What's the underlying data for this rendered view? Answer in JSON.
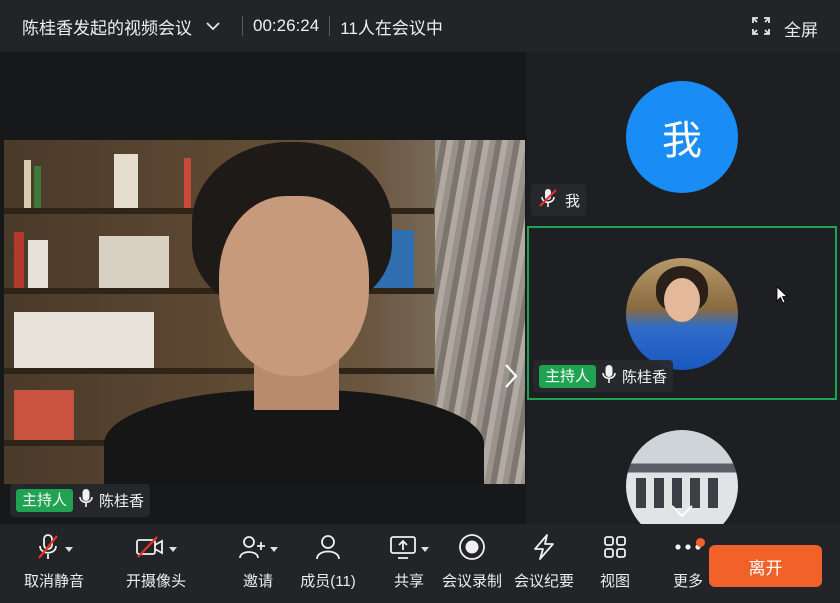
{
  "titlebar": {
    "title": "陈桂香发起的视频会议",
    "timer": "00:26:24",
    "participant_count": "11人在会议中",
    "fullscreen_label": "全屏"
  },
  "main_video": {
    "host_badge": "主持人",
    "speaker_name": "陈桂香"
  },
  "side_tiles": {
    "me_avatar_text": "我",
    "me_name": "我",
    "host_badge": "主持人",
    "host_name": "陈桂香"
  },
  "toolbar": {
    "unmute": "取消静音",
    "camera": "开摄像头",
    "invite": "邀请",
    "members": "成员(11)",
    "share": "共享",
    "record": "会议录制",
    "minutes": "会议纪要",
    "view": "视图",
    "more": "更多",
    "leave": "离开"
  },
  "colors": {
    "accent_green": "#1fa251",
    "me_avatar_blue": "#1a8cf6",
    "leave_orange": "#f3612a"
  }
}
